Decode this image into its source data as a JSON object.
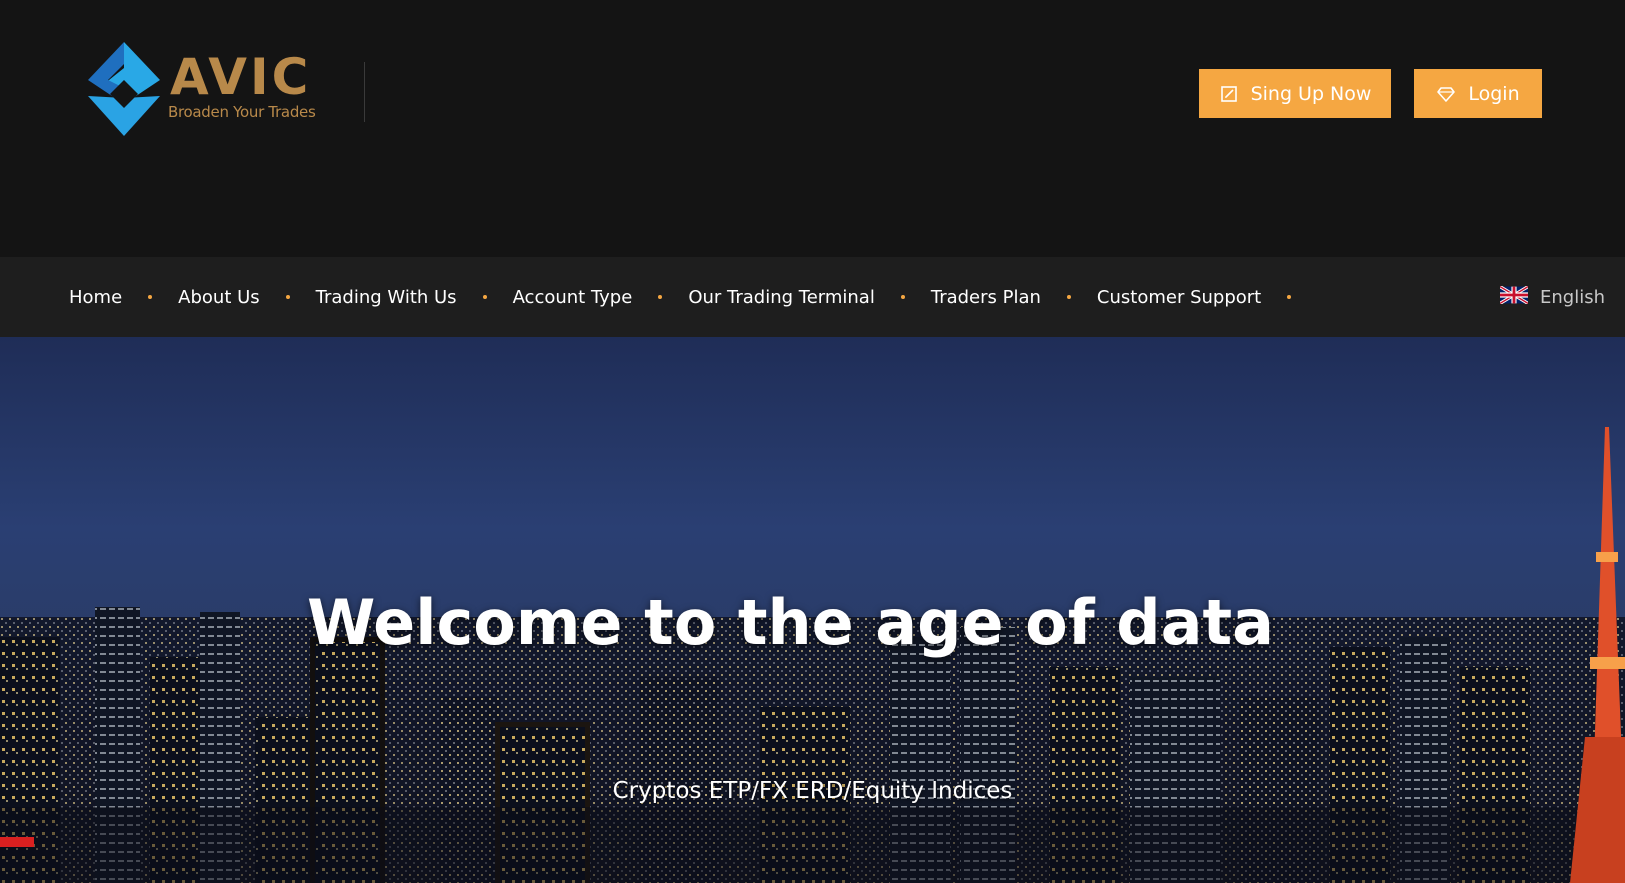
{
  "header": {
    "logo": {
      "wordmark": "AVIC",
      "tagline": "Broaden Your Trades",
      "colors": {
        "diamond": "#29a8e6",
        "wordmark": "#b8894a"
      }
    },
    "buttons": {
      "signup_label": "Sing Up Now",
      "signup_icon": "edit-square-icon",
      "login_label": "Login",
      "login_icon": "diamond-icon"
    }
  },
  "nav": {
    "items": [
      {
        "label": "Home"
      },
      {
        "label": "About Us"
      },
      {
        "label": "Trading With Us"
      },
      {
        "label": "Account Type"
      },
      {
        "label": "Our Trading Terminal"
      },
      {
        "label": "Traders Plan"
      },
      {
        "label": "Customer Support"
      }
    ],
    "language": {
      "label": "English",
      "icon": "uk-flag-icon"
    }
  },
  "hero": {
    "title": "Welcome to the age of data",
    "subtitle": "Cryptos ETP/FX ERD/Equity Indices"
  },
  "colors": {
    "accent": "#f5a742",
    "header_bg": "#141414",
    "nav_bg": "#1e1e1e"
  }
}
